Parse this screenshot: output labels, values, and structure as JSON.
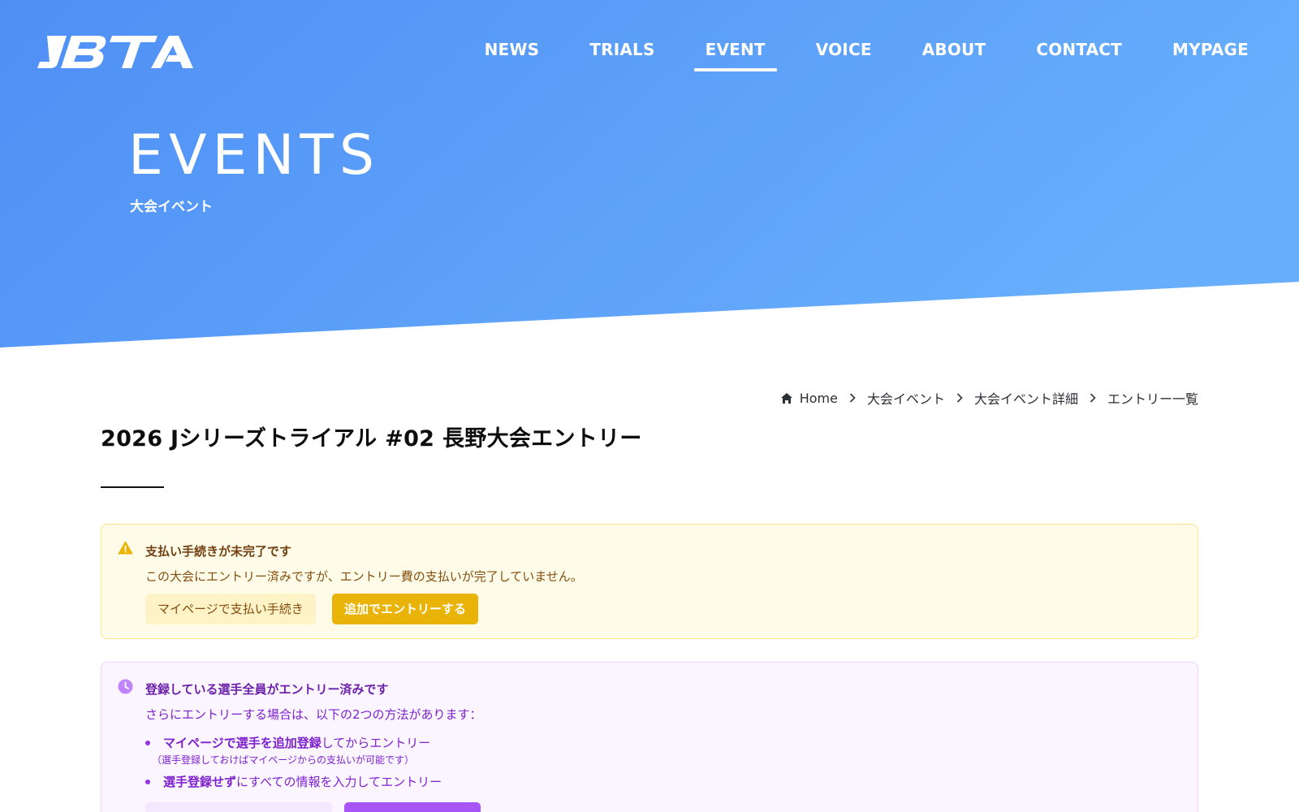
{
  "brand": {
    "logo_text": "JBTA"
  },
  "nav": {
    "items": [
      {
        "label": "NEWS"
      },
      {
        "label": "TRIALS"
      },
      {
        "label": "EVENT",
        "active": true
      },
      {
        "label": "VOICE"
      },
      {
        "label": "ABOUT"
      },
      {
        "label": "CONTACT"
      },
      {
        "label": "MYPAGE"
      }
    ]
  },
  "hero": {
    "title": "EVENTS",
    "subtitle": "大会イベント"
  },
  "breadcrumb": {
    "items": [
      {
        "label": "Home"
      },
      {
        "label": "大会イベント"
      },
      {
        "label": "大会イベント詳細"
      },
      {
        "label": "エントリー一覧"
      }
    ]
  },
  "page": {
    "title": "2026 Jシリーズトライアル #02 長野大会エントリー"
  },
  "payment_alert": {
    "heading": "支払い手続きが未完了です",
    "body": "この大会にエントリー済みですが、エントリー費の支払いが完了していません。",
    "mypage_button": "マイページで支払い手続き",
    "add_entry_button": "追加でエントリーする"
  },
  "entry_info": {
    "heading": "登録している選手全員がエントリー済みです",
    "body": "さらにエントリーする場合は、以下の2つの方法があります：",
    "option1_bold": "マイページで選手を追加登録",
    "option1_rest": "してからエントリー",
    "option1_note": "（選手登録しておけばマイページからの支払いが可能です）",
    "option2_bold": "選手登録せず",
    "option2_rest": "にすべての情報を入力してエントリー"
  },
  "colors": {
    "hero_start": "#4f8ff5",
    "hero_end": "#67aefc",
    "warning_bg": "#fefce8",
    "warning_button": "#eab308",
    "info_bg": "#faf5ff",
    "info_accent": "#a855f7"
  },
  "icons": {
    "home": "home-icon",
    "chevron": "chevron-right-icon",
    "warning": "warning-triangle-icon",
    "clock": "clock-icon"
  }
}
